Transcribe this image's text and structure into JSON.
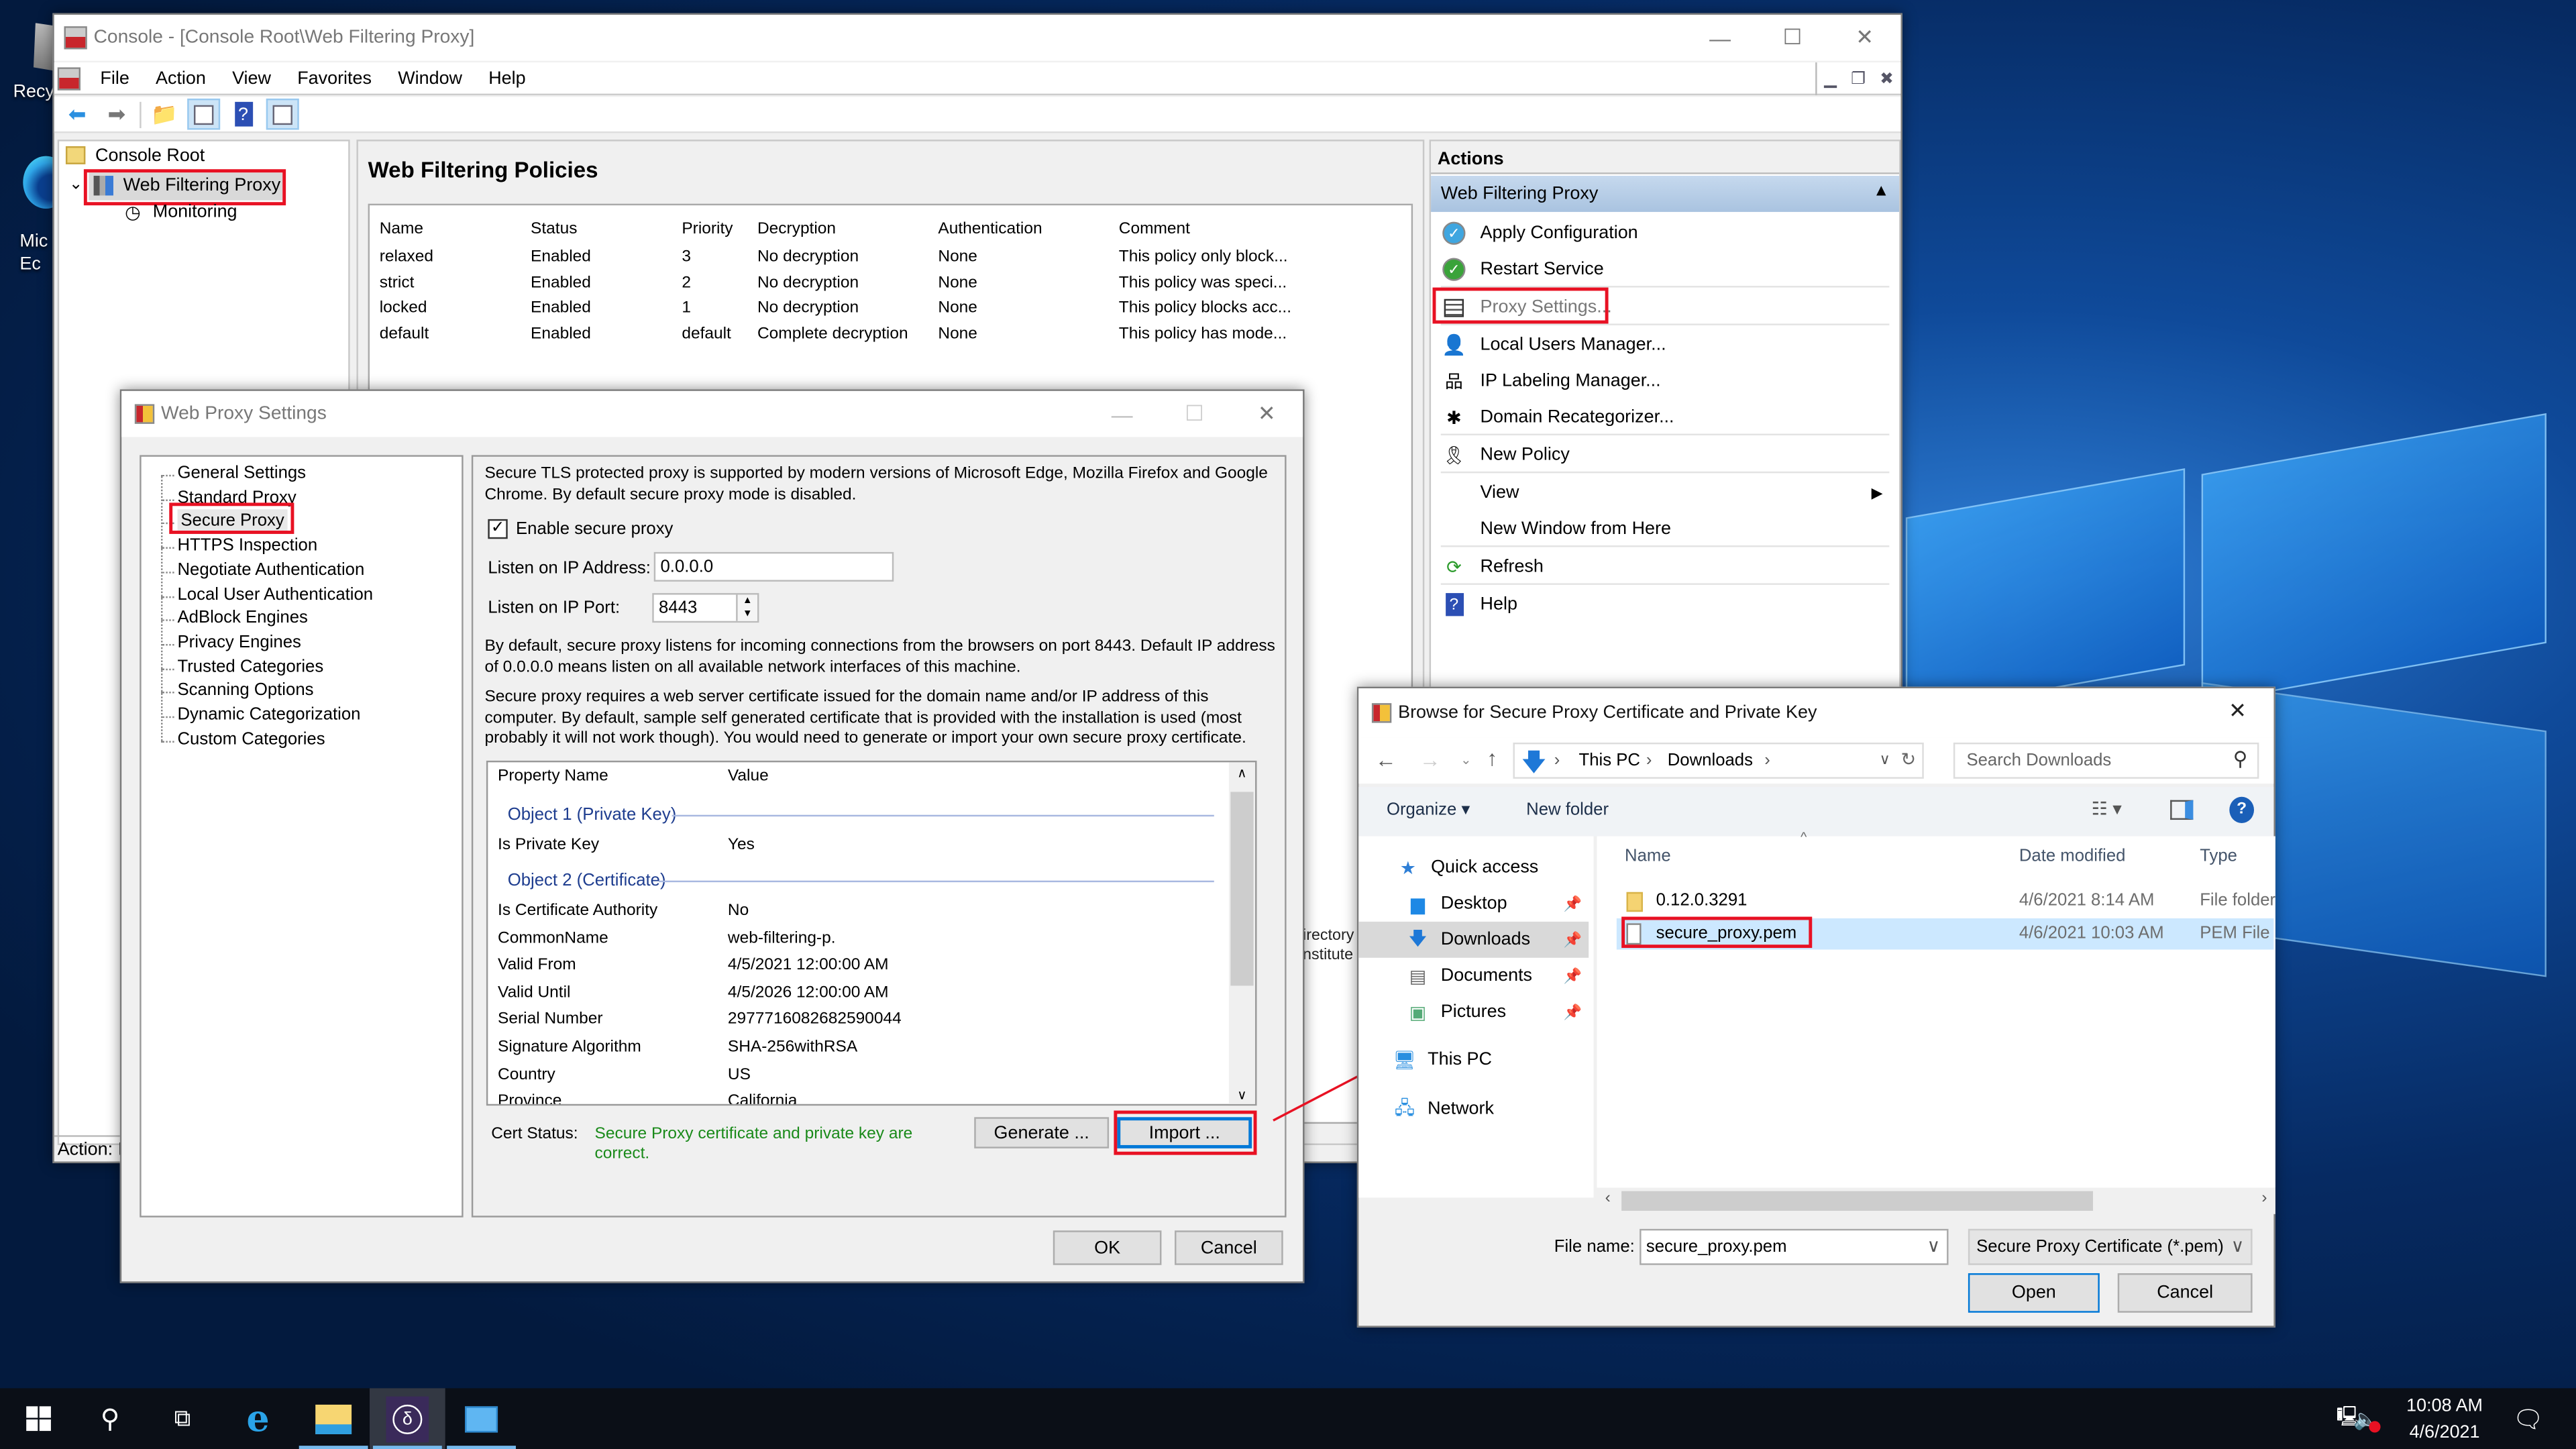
{
  "desktop": {
    "icons": [
      {
        "label": "Recy",
        "icon": "recycle-bin-icon"
      },
      {
        "label": "Mic\nEc",
        "icon": "edge-icon"
      }
    ]
  },
  "mmc": {
    "title": "Console - [Console Root\\Web Filtering Proxy]",
    "menu": [
      "File",
      "Action",
      "View",
      "Favorites",
      "Window",
      "Help"
    ],
    "toolbar_icons": [
      "back-arrow-icon",
      "forward-arrow-icon",
      "up-folder-icon",
      "show-hide-console-tree-icon",
      "help-icon",
      "show-hide-action-pane-icon"
    ],
    "tree": {
      "root": "Console Root",
      "selected": "Web Filtering Proxy",
      "child": "Monitoring"
    },
    "center": {
      "title": "Web Filtering Policies",
      "columns": [
        "Name",
        "Status",
        "Priority",
        "Decryption",
        "Authentication",
        "Comment"
      ],
      "rows": [
        [
          "relaxed",
          "Enabled",
          "3",
          "No decryption",
          "None",
          "This policy only block..."
        ],
        [
          "strict",
          "Enabled",
          "2",
          "No decryption",
          "None",
          "This policy was speci..."
        ],
        [
          "locked",
          "Enabled",
          "1",
          "No decryption",
          "None",
          "This policy blocks acc..."
        ],
        [
          "default",
          "Enabled",
          "default",
          "Complete decryption",
          "None",
          "This policy has mode..."
        ]
      ],
      "hidden_text": [
        "irectory",
        "nstitute"
      ]
    },
    "status_bar": "Action: I",
    "actions": {
      "header": "Actions",
      "group": "Web Filtering Proxy",
      "items": [
        {
          "label": "Apply Configuration",
          "icon": "apply-check-icon"
        },
        {
          "label": "Restart Service",
          "icon": "restart-check-icon"
        },
        {
          "label": "Proxy Settings...",
          "icon": "settings-form-icon",
          "highlighted": true
        },
        {
          "label": "Local Users Manager...",
          "icon": "user-icon"
        },
        {
          "label": "IP Labeling Manager...",
          "icon": "network-tree-icon"
        },
        {
          "label": "Domain Recategorizer...",
          "icon": "pin-icon"
        },
        {
          "label": "New Policy",
          "icon": "ribbon-award-icon"
        },
        {
          "label": "View",
          "icon": "",
          "submenu": true
        },
        {
          "label": "New Window from Here",
          "icon": ""
        },
        {
          "label": "Refresh",
          "icon": "refresh-icon"
        },
        {
          "label": "Help",
          "icon": "help-icon"
        }
      ]
    }
  },
  "proxy_settings": {
    "title": "Web Proxy Settings",
    "nav": [
      "General Settings",
      "Standard Proxy",
      "Secure Proxy",
      "HTTPS Inspection",
      "Negotiate Authentication",
      "Local User Authentication",
      "AdBlock Engines",
      "Privacy Engines",
      "Trusted Categories",
      "Scanning Options",
      "Dynamic Categorization",
      "Custom Categories"
    ],
    "selected_nav": "Secure Proxy",
    "intro": "Secure TLS protected proxy is supported by modern versions of Microsoft Edge, Mozilla Firefox and Google Chrome. By default secure proxy mode is disabled.",
    "enable_label": "Enable secure proxy",
    "enable_checked": true,
    "ip_label": "Listen on IP Address:",
    "ip_value": "0.0.0.0",
    "port_label": "Listen on IP Port:",
    "port_value": "8443",
    "port_note": "By default, secure proxy listens for incoming connections from the browsers on port 8443. Default IP address of 0.0.0.0 means listen on all available network interfaces of this machine.",
    "cert_note": "Secure proxy requires a web server certificate issued for the domain name and/or IP address of this computer. By default, sample self generated certificate that is provided with the installation is used (most probably it will not work though). You would need to generate or import your own secure proxy certificate.",
    "grid": {
      "columns": [
        "Property Name",
        "Value"
      ],
      "groups": [
        {
          "title": "Object 1 (Private Key)",
          "rows": [
            [
              "Is Private Key",
              "Yes"
            ]
          ]
        },
        {
          "title": "Object 2 (Certificate)",
          "rows": [
            [
              "Is Certificate Authority",
              "No"
            ],
            [
              "CommonName",
              "web-filtering-p."
            ],
            [
              "Valid From",
              "4/5/2021 12:00:00 AM"
            ],
            [
              "Valid Until",
              "4/5/2026 12:00:00 AM"
            ],
            [
              "Serial Number",
              "2977716082682590044"
            ],
            [
              "Signature Algorithm",
              "SHA-256withRSA"
            ],
            [
              "Country",
              "US"
            ],
            [
              "Province",
              "California"
            ]
          ]
        }
      ]
    },
    "cert_status_label": "Cert Status:",
    "cert_status_text": "Secure Proxy certificate and private key are correct.",
    "status_color": "#1a8a1a",
    "generate_label": "Generate ...",
    "import_label": "Import ...",
    "ok_label": "OK",
    "cancel_label": "Cancel"
  },
  "file_dialog": {
    "title": "Browse for Secure Proxy Certificate and Private Key",
    "breadcrumb": [
      "This PC",
      "Downloads"
    ],
    "search_placeholder": "Search Downloads",
    "organize_label": "Organize",
    "new_folder_label": "New folder",
    "nav": [
      {
        "label": "Quick access",
        "icon": "star-icon",
        "pinned": false
      },
      {
        "label": "Desktop",
        "icon": "desktop-icon",
        "pinned": true
      },
      {
        "label": "Downloads",
        "icon": "download-arrow-icon",
        "pinned": true,
        "selected": true
      },
      {
        "label": "Documents",
        "icon": "documents-icon",
        "pinned": true
      },
      {
        "label": "Pictures",
        "icon": "pictures-icon",
        "pinned": true
      },
      {
        "label": "This PC",
        "icon": "computer-icon",
        "pinned": false
      },
      {
        "label": "Network",
        "icon": "network-icon",
        "pinned": false
      }
    ],
    "columns": [
      "Name",
      "Date modified",
      "Type"
    ],
    "files": [
      {
        "name": "0.12.0.3291",
        "date": "4/6/2021 8:14 AM",
        "type": "File folder",
        "icon": "folder-icon"
      },
      {
        "name": "secure_proxy.pem",
        "date": "4/6/2021 10:03 AM",
        "type": "PEM File",
        "icon": "file-icon",
        "selected": true
      }
    ],
    "file_name_label": "File name:",
    "file_name_value": "secure_proxy.pem",
    "filter_value": "Secure Proxy Certificate (*.pem)",
    "open_label": "Open",
    "cancel_label": "Cancel"
  },
  "taskbar": {
    "apps": [
      "start-icon",
      "search-icon",
      "task-view-icon",
      "internet-explorer-icon",
      "file-explorer-icon",
      "delta-app-icon",
      "control-panel-icon"
    ],
    "time": "10:08 AM",
    "date": "4/6/2021"
  },
  "colors": {
    "highlight_red": "#e81123",
    "selection_blue": "#cce8ff",
    "actions_header_blue": "#b8cfe8"
  }
}
